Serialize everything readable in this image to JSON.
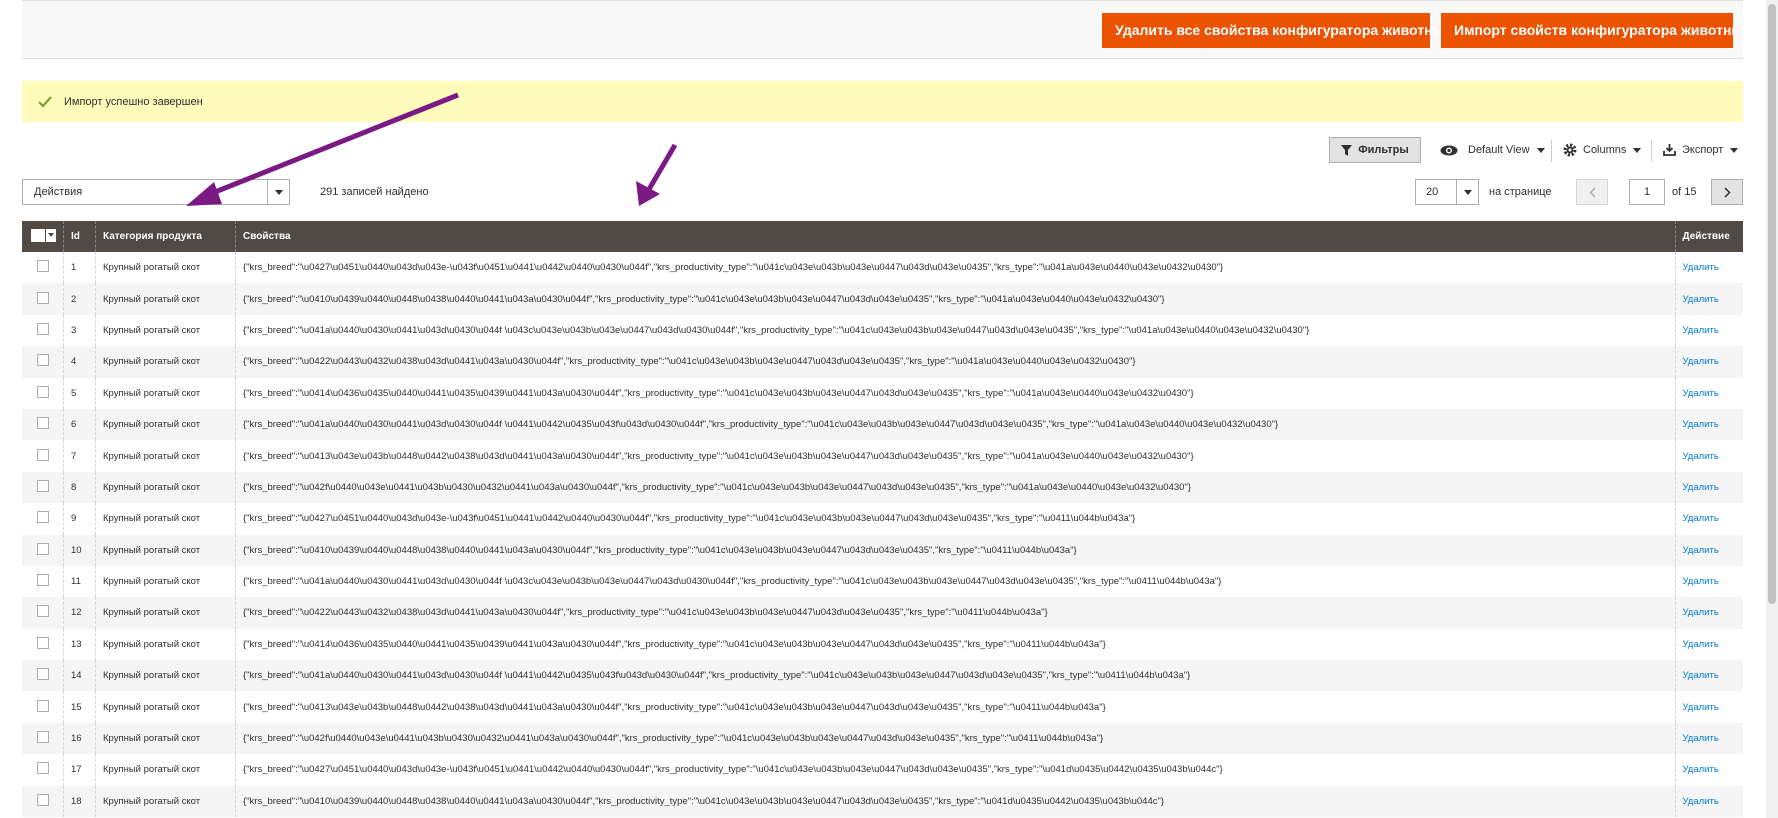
{
  "header": {
    "delete_all_label": "Удалить все свойства конфигуратора животных",
    "import_label": "Импорт свойств конфигуратора животных"
  },
  "message": {
    "text": "Импорт успешно завершен",
    "icon": "check-icon",
    "color": "#79a22e"
  },
  "toolbar": {
    "filters_label": "Фильтры",
    "view_label": "Default View",
    "columns_label": "Columns",
    "export_label": "Экспорт"
  },
  "actions": {
    "selected": "Действия"
  },
  "records_found": "291 записей найдено",
  "pager": {
    "per_page": "20",
    "per_page_label": "на странице",
    "current_page": "1",
    "total": "of 15"
  },
  "grid": {
    "columns": [
      "Id",
      "Категория продукта",
      "Свойства",
      "Действие"
    ],
    "rows": [
      {
        "id": "1",
        "category": "Крупный рогатый скот",
        "props": "{\"krs_breed\":\"\\u0427\\u0451\\u0440\\u043d\\u043e-\\u043f\\u0451\\u0441\\u0442\\u0440\\u0430\\u044f\",\"krs_productivity_type\":\"\\u041c\\u043e\\u043b\\u043e\\u0447\\u043d\\u043e\\u0435\",\"krs_type\":\"\\u041a\\u043e\\u0440\\u043e\\u0432\\u0430\"}",
        "action": "Удалить"
      },
      {
        "id": "2",
        "category": "Крупный рогатый скот",
        "props": "{\"krs_breed\":\"\\u0410\\u0439\\u0440\\u0448\\u0438\\u0440\\u0441\\u043a\\u0430\\u044f\",\"krs_productivity_type\":\"\\u041c\\u043e\\u043b\\u043e\\u0447\\u043d\\u043e\\u0435\",\"krs_type\":\"\\u041a\\u043e\\u0440\\u043e\\u0432\\u0430\"}",
        "action": "Удалить"
      },
      {
        "id": "3",
        "category": "Крупный рогатый скот",
        "props": "{\"krs_breed\":\"\\u041a\\u0440\\u0430\\u0441\\u043d\\u0430\\u044f \\u043c\\u043e\\u043b\\u043e\\u0447\\u043d\\u0430\\u044f\",\"krs_productivity_type\":\"\\u041c\\u043e\\u043b\\u043e\\u0447\\u043d\\u043e\\u0435\",\"krs_type\":\"\\u041a\\u043e\\u0440\\u043e\\u0432\\u0430\"}",
        "action": "Удалить"
      },
      {
        "id": "4",
        "category": "Крупный рогатый скот",
        "props": "{\"krs_breed\":\"\\u0422\\u0443\\u0432\\u0438\\u043d\\u0441\\u043a\\u0430\\u044f\",\"krs_productivity_type\":\"\\u041c\\u043e\\u043b\\u043e\\u0447\\u043d\\u043e\\u0435\",\"krs_type\":\"\\u041a\\u043e\\u0440\\u043e\\u0432\\u0430\"}",
        "action": "Удалить"
      },
      {
        "id": "5",
        "category": "Крупный рогатый скот",
        "props": "{\"krs_breed\":\"\\u0414\\u0436\\u0435\\u0440\\u0441\\u0435\\u0439\\u0441\\u043a\\u0430\\u044f\",\"krs_productivity_type\":\"\\u041c\\u043e\\u043b\\u043e\\u0447\\u043d\\u043e\\u0435\",\"krs_type\":\"\\u041a\\u043e\\u0440\\u043e\\u0432\\u0430\"}",
        "action": "Удалить"
      },
      {
        "id": "6",
        "category": "Крупный рогатый скот",
        "props": "{\"krs_breed\":\"\\u041a\\u0440\\u0430\\u0441\\u043d\\u0430\\u044f \\u0441\\u0442\\u0435\\u043f\\u043d\\u0430\\u044f\",\"krs_productivity_type\":\"\\u041c\\u043e\\u043b\\u043e\\u0447\\u043d\\u043e\\u0435\",\"krs_type\":\"\\u041a\\u043e\\u0440\\u043e\\u0432\\u0430\"}",
        "action": "Удалить"
      },
      {
        "id": "7",
        "category": "Крупный рогатый скот",
        "props": "{\"krs_breed\":\"\\u0413\\u043e\\u043b\\u0448\\u0442\\u0438\\u043d\\u0441\\u043a\\u0430\\u044f\",\"krs_productivity_type\":\"\\u041c\\u043e\\u043b\\u043e\\u0447\\u043d\\u043e\\u0435\",\"krs_type\":\"\\u041a\\u043e\\u0440\\u043e\\u0432\\u0430\"}",
        "action": "Удалить"
      },
      {
        "id": "8",
        "category": "Крупный рогатый скот",
        "props": "{\"krs_breed\":\"\\u042f\\u0440\\u043e\\u0441\\u043b\\u0430\\u0432\\u0441\\u043a\\u0430\\u044f\",\"krs_productivity_type\":\"\\u041c\\u043e\\u043b\\u043e\\u0447\\u043d\\u043e\\u0435\",\"krs_type\":\"\\u041a\\u043e\\u0440\\u043e\\u0432\\u0430\"}",
        "action": "Удалить"
      },
      {
        "id": "9",
        "category": "Крупный рогатый скот",
        "props": "{\"krs_breed\":\"\\u0427\\u0451\\u0440\\u043d\\u043e-\\u043f\\u0451\\u0441\\u0442\\u0440\\u0430\\u044f\",\"krs_productivity_type\":\"\\u041c\\u043e\\u043b\\u043e\\u0447\\u043d\\u043e\\u0435\",\"krs_type\":\"\\u0411\\u044b\\u043a\"}",
        "action": "Удалить"
      },
      {
        "id": "10",
        "category": "Крупный рогатый скот",
        "props": "{\"krs_breed\":\"\\u0410\\u0439\\u0440\\u0448\\u0438\\u0440\\u0441\\u043a\\u0430\\u044f\",\"krs_productivity_type\":\"\\u041c\\u043e\\u043b\\u043e\\u0447\\u043d\\u043e\\u0435\",\"krs_type\":\"\\u0411\\u044b\\u043a\"}",
        "action": "Удалить"
      },
      {
        "id": "11",
        "category": "Крупный рогатый скот",
        "props": "{\"krs_breed\":\"\\u041a\\u0440\\u0430\\u0441\\u043d\\u0430\\u044f \\u043c\\u043e\\u043b\\u043e\\u0447\\u043d\\u0430\\u044f\",\"krs_productivity_type\":\"\\u041c\\u043e\\u043b\\u043e\\u0447\\u043d\\u043e\\u0435\",\"krs_type\":\"\\u0411\\u044b\\u043a\"}",
        "action": "Удалить"
      },
      {
        "id": "12",
        "category": "Крупный рогатый скот",
        "props": "{\"krs_breed\":\"\\u0422\\u0443\\u0432\\u0438\\u043d\\u0441\\u043a\\u0430\\u044f\",\"krs_productivity_type\":\"\\u041c\\u043e\\u043b\\u043e\\u0447\\u043d\\u043e\\u0435\",\"krs_type\":\"\\u0411\\u044b\\u043a\"}",
        "action": "Удалить"
      },
      {
        "id": "13",
        "category": "Крупный рогатый скот",
        "props": "{\"krs_breed\":\"\\u0414\\u0436\\u0435\\u0440\\u0441\\u0435\\u0439\\u0441\\u043a\\u0430\\u044f\",\"krs_productivity_type\":\"\\u041c\\u043e\\u043b\\u043e\\u0447\\u043d\\u043e\\u0435\",\"krs_type\":\"\\u0411\\u044b\\u043a\"}",
        "action": "Удалить"
      },
      {
        "id": "14",
        "category": "Крупный рогатый скот",
        "props": "{\"krs_breed\":\"\\u041a\\u0440\\u0430\\u0441\\u043d\\u0430\\u044f \\u0441\\u0442\\u0435\\u043f\\u043d\\u0430\\u044f\",\"krs_productivity_type\":\"\\u041c\\u043e\\u043b\\u043e\\u0447\\u043d\\u043e\\u0435\",\"krs_type\":\"\\u0411\\u044b\\u043a\"}",
        "action": "Удалить"
      },
      {
        "id": "15",
        "category": "Крупный рогатый скот",
        "props": "{\"krs_breed\":\"\\u0413\\u043e\\u043b\\u0448\\u0442\\u0438\\u043d\\u0441\\u043a\\u0430\\u044f\",\"krs_productivity_type\":\"\\u041c\\u043e\\u043b\\u043e\\u0447\\u043d\\u043e\\u0435\",\"krs_type\":\"\\u0411\\u044b\\u043a\"}",
        "action": "Удалить"
      },
      {
        "id": "16",
        "category": "Крупный рогатый скот",
        "props": "{\"krs_breed\":\"\\u042f\\u0440\\u043e\\u0441\\u043b\\u0430\\u0432\\u0441\\u043a\\u0430\\u044f\",\"krs_productivity_type\":\"\\u041c\\u043e\\u043b\\u043e\\u0447\\u043d\\u043e\\u0435\",\"krs_type\":\"\\u0411\\u044b\\u043a\"}",
        "action": "Удалить"
      },
      {
        "id": "17",
        "category": "Крупный рогатый скот",
        "props": "{\"krs_breed\":\"\\u0427\\u0451\\u0440\\u043d\\u043e-\\u043f\\u0451\\u0441\\u0442\\u0440\\u0430\\u044f\",\"krs_productivity_type\":\"\\u041c\\u043e\\u043b\\u043e\\u0447\\u043d\\u043e\\u0435\",\"krs_type\":\"\\u041d\\u0435\\u0442\\u0435\\u043b\\u044c\"}",
        "action": "Удалить"
      },
      {
        "id": "18",
        "category": "Крупный рогатый скот",
        "props": "{\"krs_breed\":\"\\u0410\\u0439\\u0440\\u0448\\u0438\\u0440\\u0441\\u043a\\u0430\\u044f\",\"krs_productivity_type\":\"\\u041c\\u043e\\u043b\\u043e\\u0447\\u043d\\u043e\\u0435\",\"krs_type\":\"\\u041d\\u0435\\u0442\\u0435\\u043b\\u044c\"}",
        "action": "Удалить"
      }
    ]
  },
  "colors": {
    "accent": "#eb5202",
    "header_bg": "#514943",
    "message_bg": "#fffbbb",
    "link": "#007bdb",
    "annotation_arrow": "#7b1a85"
  }
}
